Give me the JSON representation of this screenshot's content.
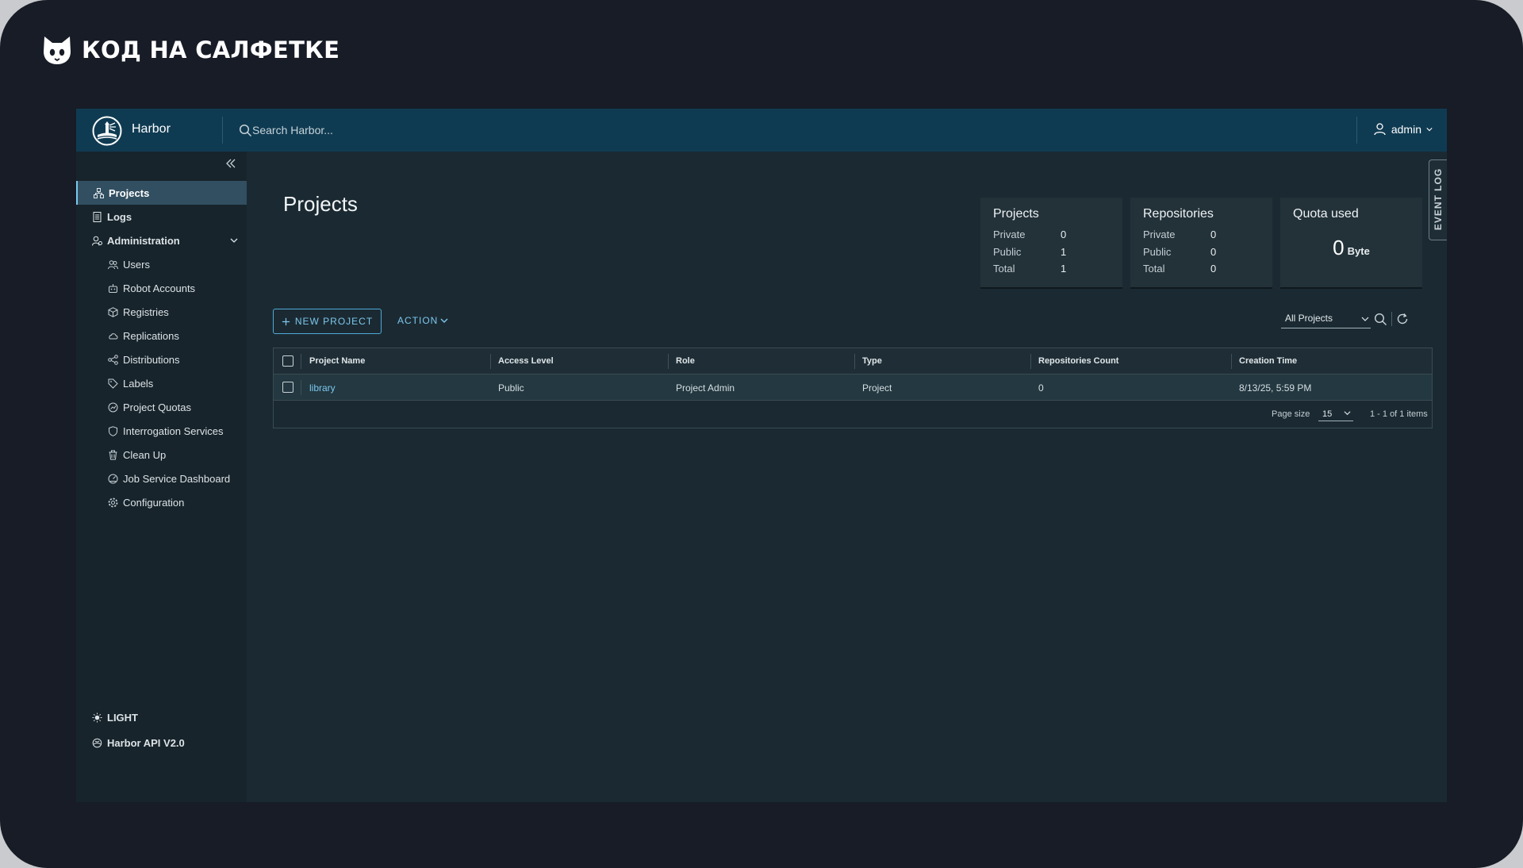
{
  "brand": {
    "text": "КОД НА САЛФЕТКЕ"
  },
  "header": {
    "app_name": "Harbor",
    "search_placeholder": "Search Harbor...",
    "user": "admin"
  },
  "sidebar": {
    "items": [
      {
        "label": "Projects",
        "icon": "projects-icon",
        "active": true
      },
      {
        "label": "Logs",
        "icon": "logs-icon"
      },
      {
        "label": "Administration",
        "icon": "administration-icon",
        "expanded": true
      }
    ],
    "sub_items": [
      {
        "label": "Users",
        "icon": "users-icon"
      },
      {
        "label": "Robot Accounts",
        "icon": "robot-icon"
      },
      {
        "label": "Registries",
        "icon": "registries-icon"
      },
      {
        "label": "Replications",
        "icon": "replications-icon"
      },
      {
        "label": "Distributions",
        "icon": "distributions-icon"
      },
      {
        "label": "Labels",
        "icon": "labels-icon"
      },
      {
        "label": "Project Quotas",
        "icon": "quotas-icon"
      },
      {
        "label": "Interrogation Services",
        "icon": "shield-icon"
      },
      {
        "label": "Clean Up",
        "icon": "trash-icon"
      },
      {
        "label": "Job Service Dashboard",
        "icon": "dashboard-icon"
      },
      {
        "label": "Configuration",
        "icon": "gear-icon"
      }
    ],
    "theme_label": "LIGHT",
    "api_label": "Harbor API V2.0"
  },
  "main": {
    "title": "Projects",
    "new_project_label": "NEW PROJECT",
    "action_label": "ACTION",
    "filter_value": "All Projects",
    "event_log_label": "EVENT LOG"
  },
  "cards": {
    "projects": {
      "title": "Projects",
      "private_label": "Private",
      "private": "0",
      "public_label": "Public",
      "public": "1",
      "total_label": "Total",
      "total": "1"
    },
    "repositories": {
      "title": "Repositories",
      "private_label": "Private",
      "private": "0",
      "public_label": "Public",
      "public": "0",
      "total_label": "Total",
      "total": "0"
    },
    "quota": {
      "title": "Quota used",
      "value": "0",
      "unit": "Byte"
    }
  },
  "table": {
    "columns": [
      "Project Name",
      "Access Level",
      "Role",
      "Type",
      "Repositories Count",
      "Creation Time"
    ],
    "rows": [
      [
        "library",
        "Public",
        "Project Admin",
        "Project",
        "0",
        "8/13/25, 5:59 PM"
      ]
    ],
    "page_size_label": "Page size",
    "page_size": "15",
    "count_text": "1 - 1 of 1 items"
  },
  "colors": {
    "accent": "#7cc7ee",
    "header_bg": "#0f3b52",
    "sidebar_bg": "#17242b",
    "content_bg": "#1b2a32"
  }
}
